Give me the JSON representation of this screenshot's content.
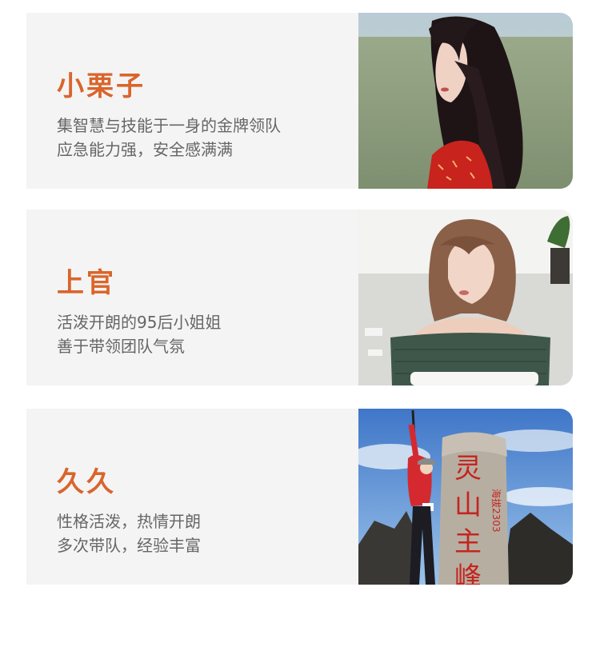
{
  "profiles": [
    {
      "name": "小栗子",
      "lines": [
        "集智慧与技能于一身的金牌领队",
        "应急能力强，安全感满满"
      ]
    },
    {
      "name": "上官",
      "lines": [
        "活泼开朗的95后小姐姐",
        "善于带领团队气氛"
      ]
    },
    {
      "name": "久久",
      "lines": [
        "性格活泼，热情开朗",
        "多次带队，经验丰富"
      ]
    }
  ],
  "photo3_sign": [
    "灵",
    "山",
    "主",
    "峰",
    "海拔2303"
  ],
  "colors": {
    "accent": "#d9652b",
    "card_bg": "#f4f4f4",
    "text": "#666666"
  }
}
